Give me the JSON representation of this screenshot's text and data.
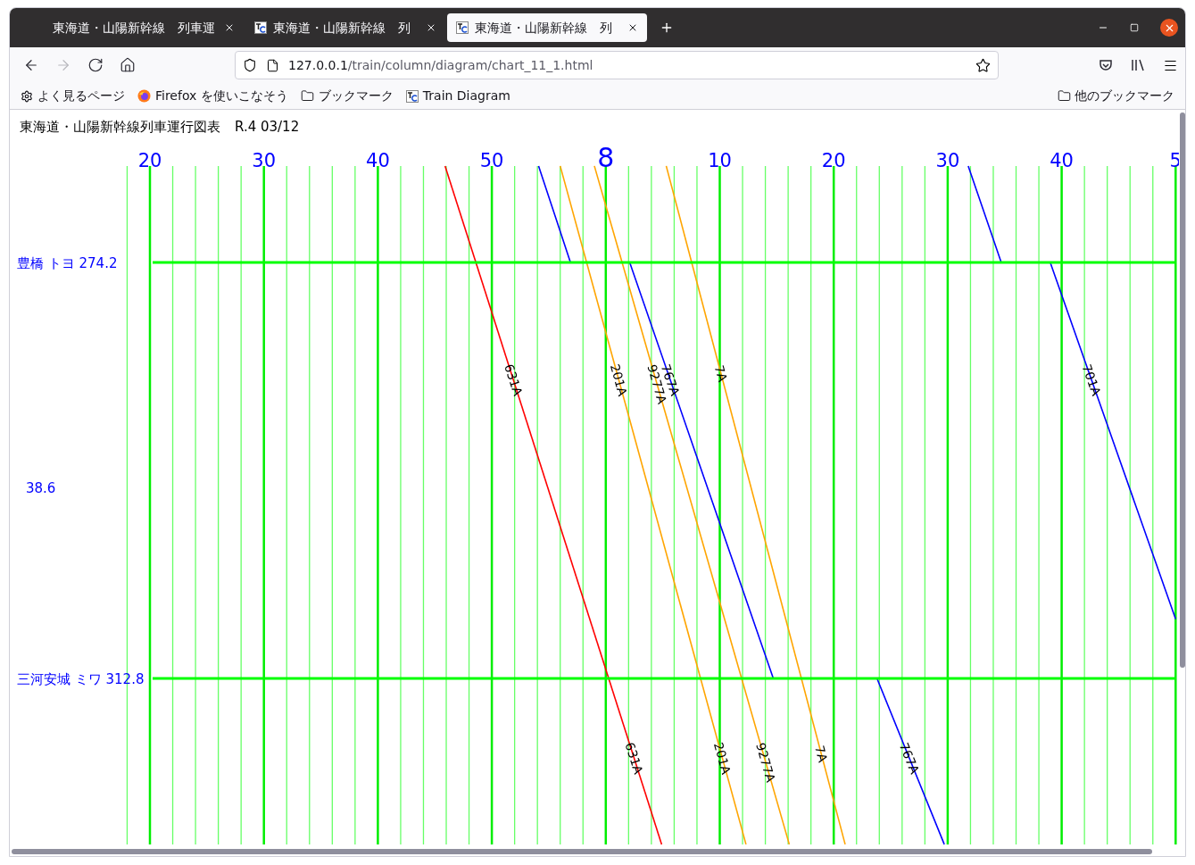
{
  "tabs": [
    {
      "title": "東海道・山陽新幹線　列車運",
      "favicon": false,
      "selected": false
    },
    {
      "title": "東海道・山陽新幹線　列",
      "favicon": true,
      "selected": false
    },
    {
      "title": "東海道・山陽新幹線　列",
      "favicon": true,
      "selected": true
    }
  ],
  "nav_buttons": [
    {
      "kind": "back",
      "disabled": false
    },
    {
      "kind": "forward",
      "disabled": true
    },
    {
      "kind": "reload",
      "disabled": false
    },
    {
      "kind": "home",
      "disabled": false
    }
  ],
  "address": {
    "host": "127.0.0.1",
    "path": "/train/column/diagram/chart_11_1.html"
  },
  "bookmarks": [
    {
      "kind": "gear",
      "label": "よく見るページ"
    },
    {
      "kind": "firefox",
      "label": "Firefox を使いこなそう"
    },
    {
      "kind": "folder",
      "label": "ブックマーク"
    },
    {
      "kind": "tg",
      "label": "Train Diagram"
    }
  ],
  "other_bookmarks": {
    "label": "他のブックマーク"
  },
  "page": {
    "title": "東海道・山陽新幹線列車運行図表",
    "date": "R.4 03/12"
  },
  "diagram": {
    "time_labels": [
      {
        "label": "20",
        "hour": false
      },
      {
        "label": "30",
        "hour": false
      },
      {
        "label": "40",
        "hour": false
      },
      {
        "label": "50",
        "hour": false
      },
      {
        "label": "8",
        "hour": true
      },
      {
        "label": "10",
        "hour": false
      },
      {
        "label": "20",
        "hour": false
      },
      {
        "label": "30",
        "hour": false
      },
      {
        "label": "40",
        "hour": false
      },
      {
        "label": "5",
        "hour": false
      }
    ],
    "stations": [
      {
        "label": "豊橋 トヨ 274.2"
      },
      {
        "label": "三河安城 ミワ 312.8"
      }
    ],
    "section_distance": "38.6",
    "trains": [
      {
        "color": "#ff0000",
        "labels": [
          "631A",
          "631A"
        ]
      },
      {
        "color": "#ffa500",
        "labels": [
          "201A",
          "201A"
        ]
      },
      {
        "color": "#ffa500",
        "labels": [
          "9277A",
          "9277A"
        ]
      },
      {
        "color": "#0000ff",
        "labels": [
          "767A",
          "767A"
        ]
      },
      {
        "color": "#ffa500",
        "labels": [
          "7A",
          "7A"
        ]
      },
      {
        "color": "#0000ff",
        "labels": [
          "701A"
        ]
      }
    ]
  }
}
